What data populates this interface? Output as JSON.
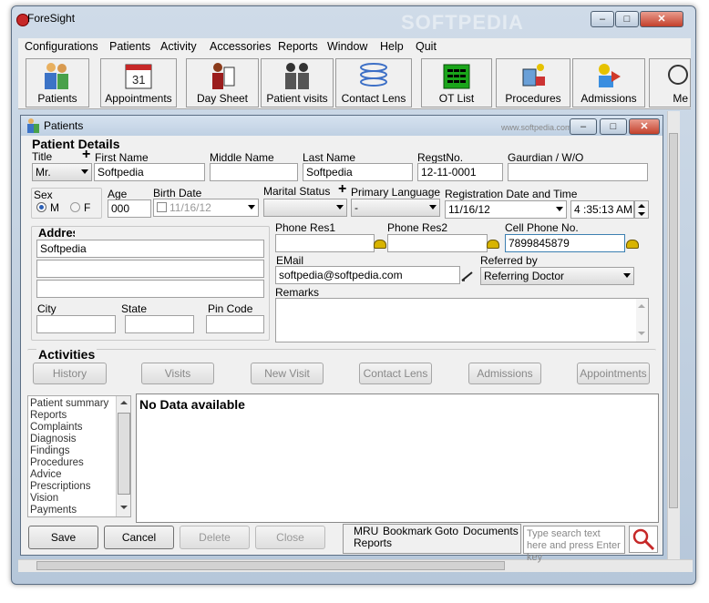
{
  "app": {
    "title": "ForeSight"
  },
  "menu": [
    "Configurations",
    "Patients",
    "Activity",
    "Accessories",
    "Reports",
    "Window",
    "Help",
    "Quit"
  ],
  "toolbar": [
    "Patients",
    "Appointments",
    "Day Sheet",
    "Patient visits",
    "Contact Lens",
    "OT List",
    "Procedures",
    "Admissions",
    "Me"
  ],
  "watermark": "SOFTPEDIA",
  "patient_window": {
    "title": "Patients",
    "watermark": "www.softpedia.com",
    "section_title": "Patient Details",
    "labels": {
      "title": "Title",
      "first_name": "First Name",
      "middle_name": "Middle Name",
      "last_name": "Last Name",
      "regst_no": "RegstNo.",
      "guardian": "Gaurdian / W/O",
      "sex": "Sex",
      "male": "M",
      "female": "F",
      "age": "Age",
      "birth_date": "Birth Date",
      "marital_status": "Marital Status",
      "primary_language": "Primary Language",
      "reg_datetime": "Registration Date and Time",
      "address": "Address",
      "city": "City",
      "state": "State",
      "pin_code": "Pin Code",
      "phone_res1": "Phone Res1",
      "phone_res2": "Phone Res2",
      "cell_phone": "Cell Phone No.",
      "email": "EMail",
      "referred_by": "Referred by",
      "remarks": "Remarks"
    },
    "values": {
      "title": "Mr.",
      "first_name": "Softpedia",
      "middle_name": "",
      "last_name": "Softpedia",
      "regst_no": "12-11-0001",
      "guardian": "",
      "age": "000",
      "birth_date": "11/16/12",
      "marital_status": "",
      "primary_language": "-",
      "reg_date": "11/16/12",
      "reg_time": "4 :35:13 AM",
      "address_line1": "Softpedia",
      "city": "",
      "state": "",
      "pin_code": "",
      "phone_res1": "",
      "phone_res2": "",
      "cell_phone": "7899845879",
      "email": "softpedia@softpedia.com",
      "referred_by": "Referring Doctor",
      "remarks": ""
    },
    "activities": {
      "title": "Activities",
      "buttons": [
        "History",
        "Visits",
        "New Visit",
        "Contact Lens",
        "Admissions",
        "Appointments"
      ]
    },
    "summary_list": [
      "Patient summary",
      "Reports",
      "Complaints",
      "Diagnosis",
      "Findings",
      "Procedures",
      "Advice",
      "Prescriptions",
      "Vision",
      "Payments"
    ],
    "no_data": "No Data available",
    "bottom_buttons": [
      "Save",
      "Cancel",
      "Delete",
      "Close"
    ],
    "links": [
      "MRU",
      "Bookmark",
      "Goto",
      "Documents",
      "Reports"
    ],
    "search_placeholder": "Type search text here and press Enter key"
  },
  "colors": {
    "title_bar": "#c7d6e6",
    "accent_yellow": "#d8b400",
    "close_red": "#c3402b"
  }
}
